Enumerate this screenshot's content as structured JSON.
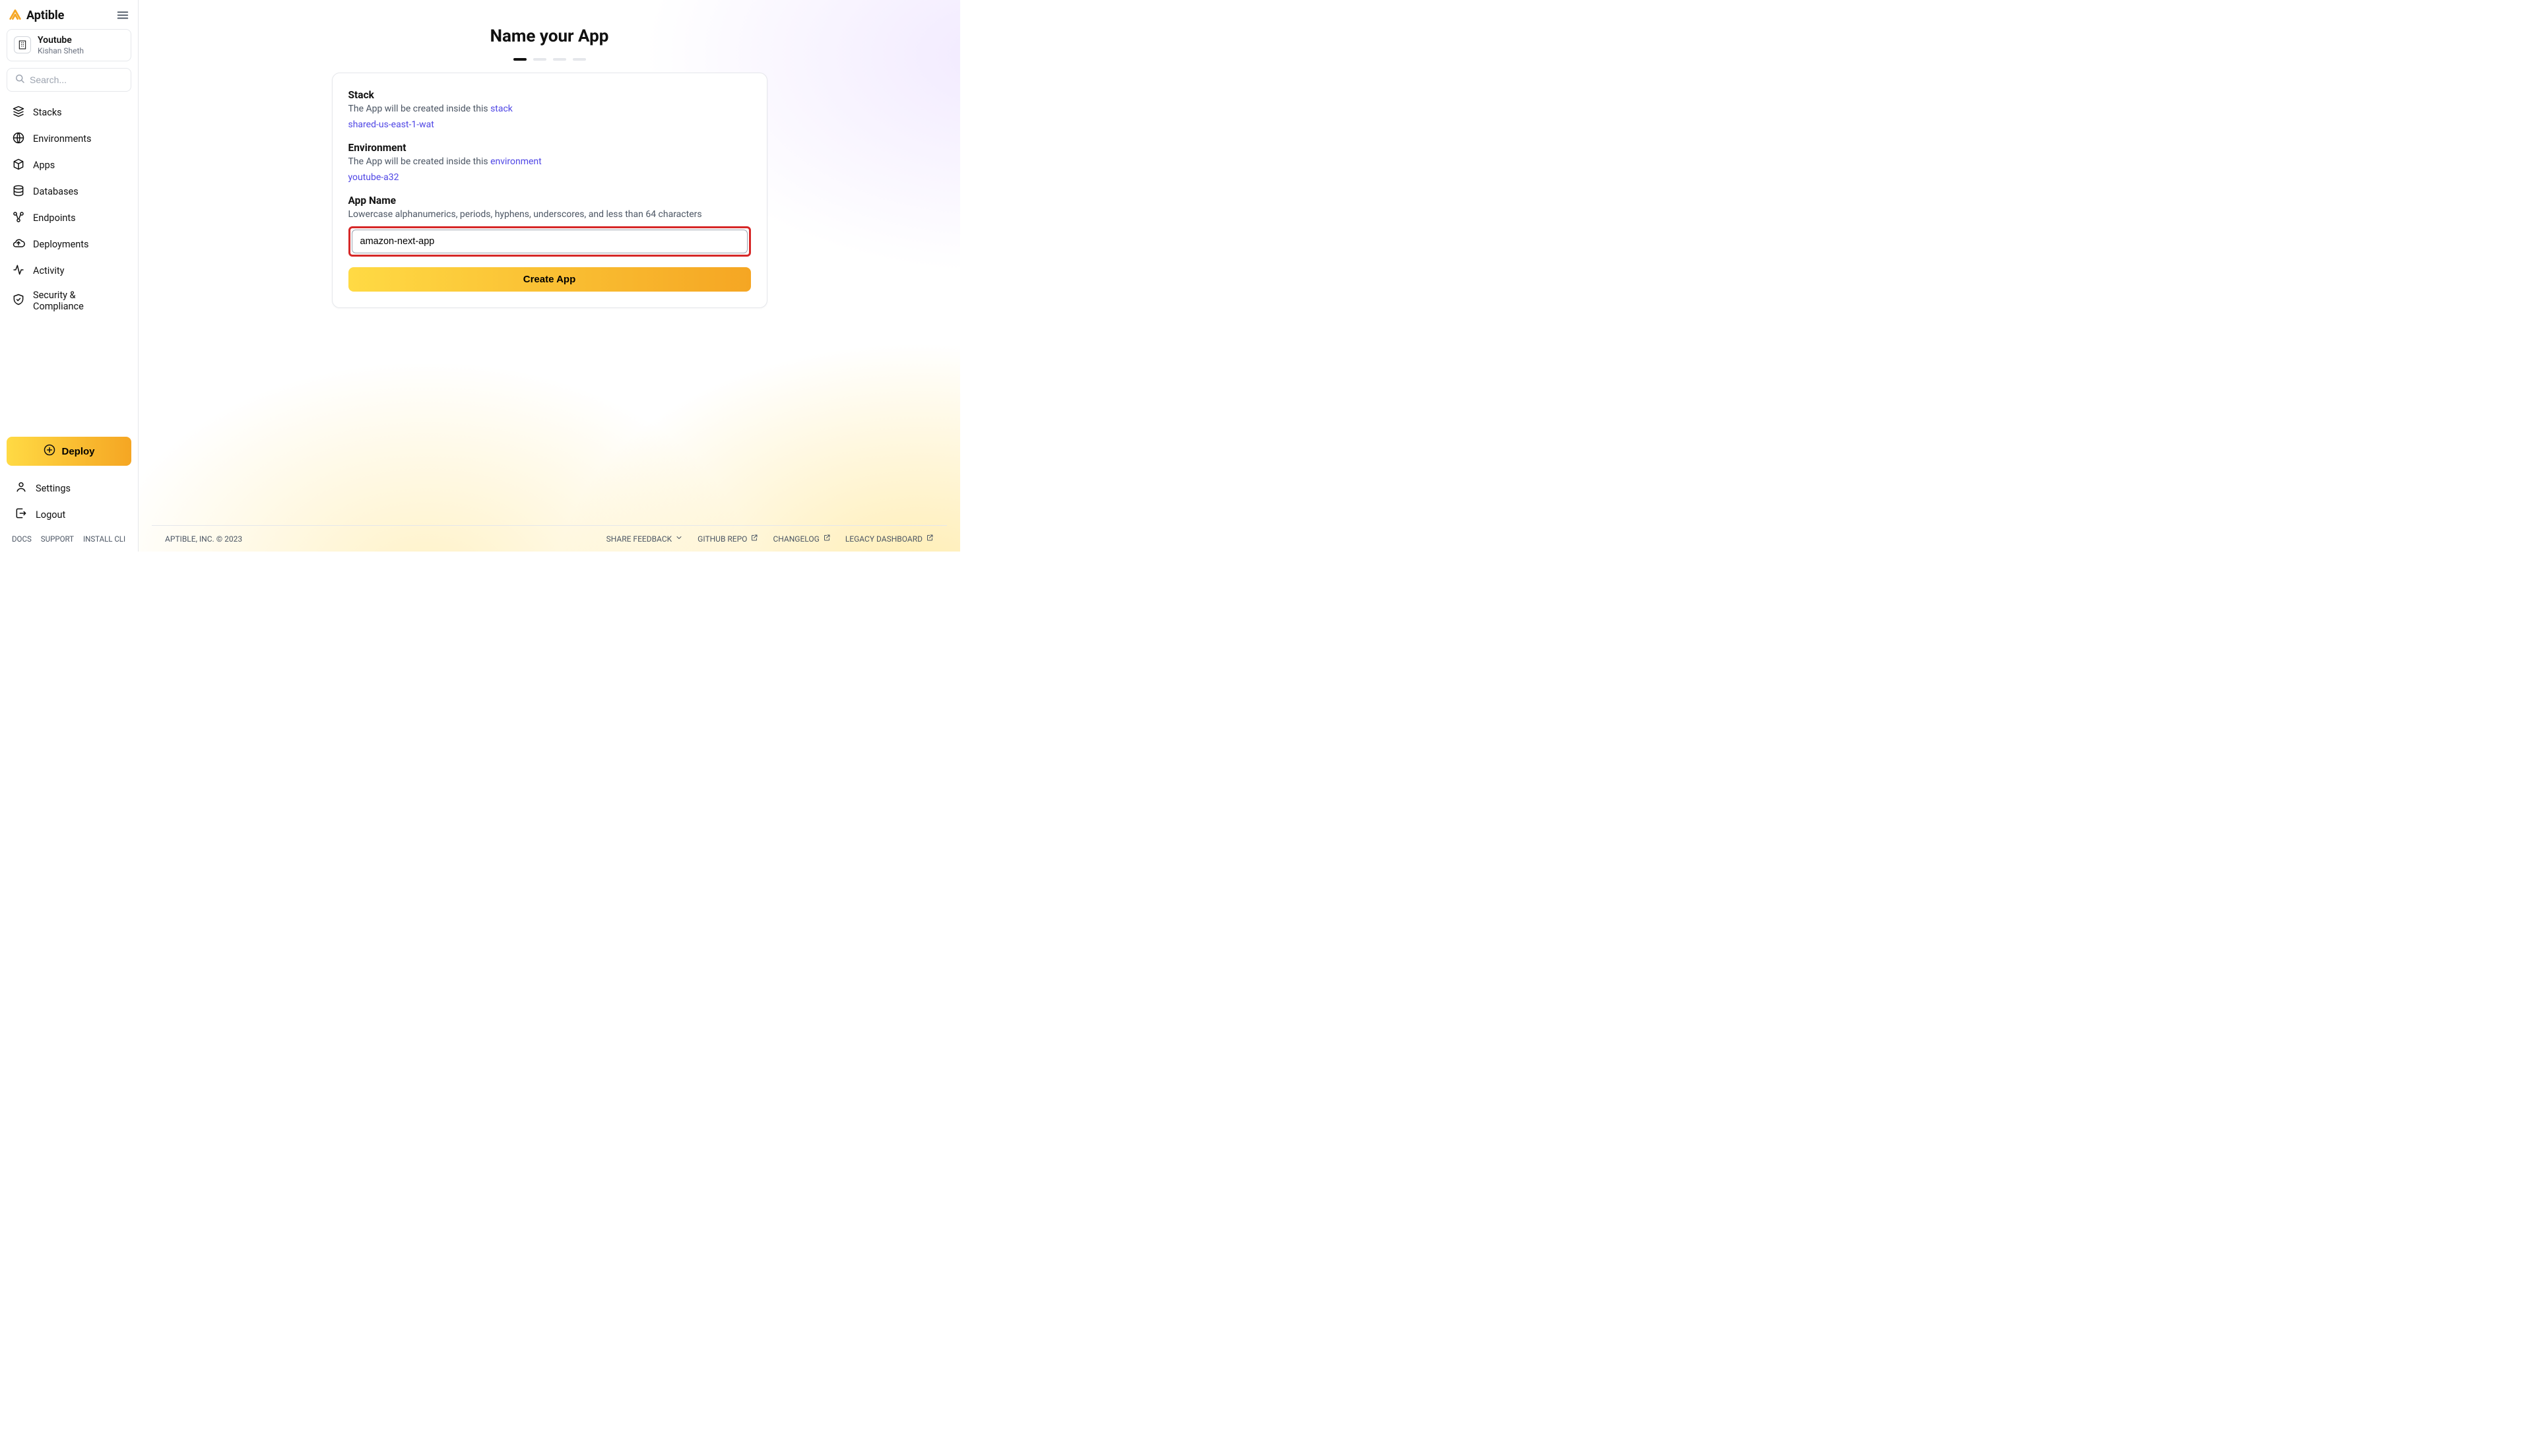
{
  "brand": "Aptible",
  "org": {
    "name": "Youtube",
    "user": "Kishan Sheth"
  },
  "search": {
    "placeholder": "Search..."
  },
  "nav": {
    "stacks": "Stacks",
    "environments": "Environments",
    "apps": "Apps",
    "databases": "Databases",
    "endpoints": "Endpoints",
    "deployments": "Deployments",
    "activity": "Activity",
    "security": "Security & Compliance"
  },
  "deploy": "Deploy",
  "settings": "Settings",
  "logout": "Logout",
  "mini": {
    "docs": "DOCS",
    "support": "SUPPORT",
    "install": "INSTALL CLI"
  },
  "page": {
    "title": "Name your App",
    "stack": {
      "title": "Stack",
      "desc_prefix": "The App will be created inside this ",
      "desc_link": "stack",
      "value": "shared-us-east-1-wat"
    },
    "env": {
      "title": "Environment",
      "desc_prefix": "The App will be created inside this ",
      "desc_link": "environment",
      "value": "youtube-a32"
    },
    "appname": {
      "title": "App Name",
      "hint": "Lowercase alphanumerics, periods, hyphens, underscores, and less than 64 characters",
      "value": "amazon-next-app"
    },
    "create_btn": "Create App"
  },
  "footer": {
    "copyright": "APTIBLE, INC. © 2023",
    "feedback": "SHARE FEEDBACK",
    "github": "GITHUB REPO",
    "changelog": "CHANGELOG",
    "legacy": "LEGACY DASHBOARD"
  }
}
